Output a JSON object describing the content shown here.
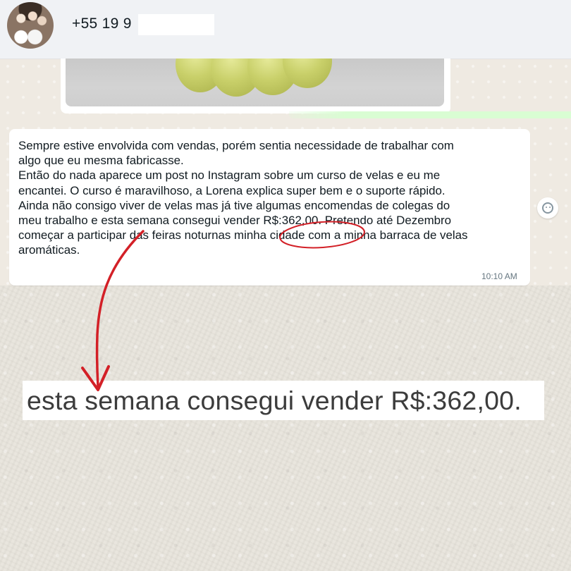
{
  "header": {
    "contact_name": "+55 19 9          04"
  },
  "message": {
    "lines": [
      "Sempre estive envolvida com vendas, porém sentia necessidade de trabalhar com",
      "algo que eu mesma fabricasse.",
      "Então do nada aparece um post no Instagram sobre um curso de velas e eu me",
      "encantei. O curso é maravilhoso, a Lorena explica super bem e o suporte rápido.",
      "Ainda não consigo viver de velas mas já tive algumas encomendas de colegas do",
      "meu trabalho e esta semana consegui vender R$:362,00. Pretendo até Dezembro",
      "começar a participar das feiras noturnas minha cidade com a minha barraca de velas",
      "aromáticas."
    ],
    "time": "10:10 AM"
  },
  "zoom": {
    "text": "esta semana consegui vender R$:362,00."
  },
  "icons": {
    "emoji": "emoji-smiley-icon",
    "annotation_arrow": "red-arrow-icon",
    "annotation_circle": "red-circle-icon"
  },
  "colors": {
    "header_bg": "#f0f2f5",
    "bubble_bg": "#ffffff",
    "outgoing_bubble": "#d9fdd3",
    "annotation_red": "#d32027",
    "time_text": "#667781"
  }
}
